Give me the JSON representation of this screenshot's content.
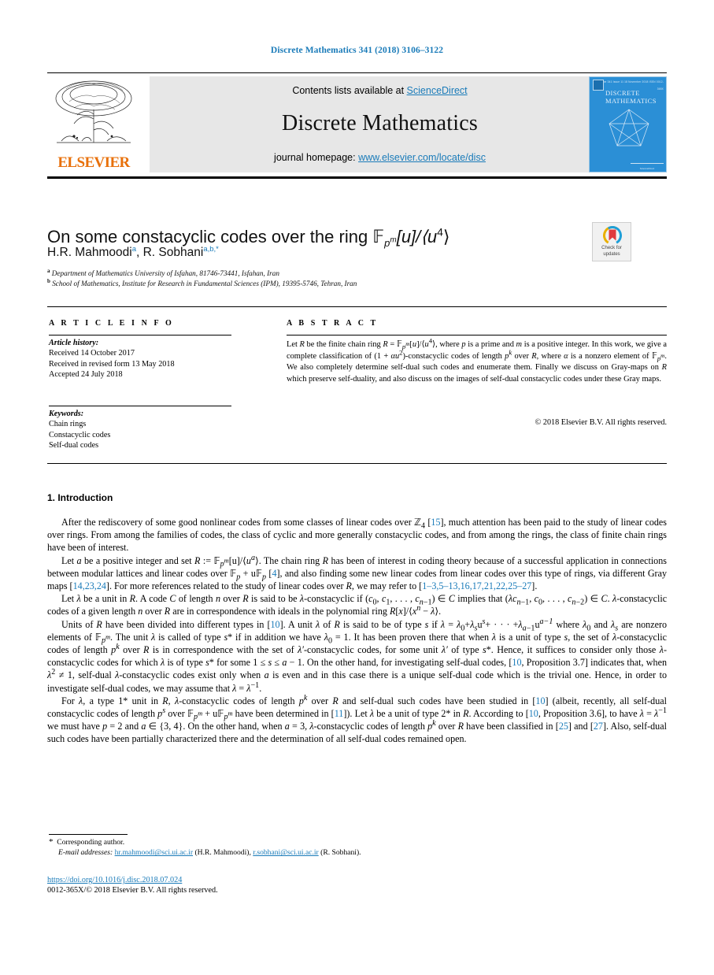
{
  "running_head": "Discrete Mathematics 341 (2018) 3106–3122",
  "masthead": {
    "contents_prefix": "Contents lists available at ",
    "contents_link": "ScienceDirect",
    "journal_title": "Discrete Mathematics",
    "homepage_prefix": "journal homepage: ",
    "homepage_url": "www.elsevier.com/locate/disc",
    "publisher": "ELSEVIER",
    "cover": {
      "journal_name_line1": "DISCRETE",
      "journal_name_line2": "MATHEMATICS",
      "top_strip": "Volume 341   Issue 11   18 November 2018   ISSN 0012-365X"
    }
  },
  "article": {
    "title": "On some constacyclic codes over the ring 𝔽_{p^m}[u]/⟨u⁴⟩",
    "title_parts": {
      "lead": "On some constacyclic codes over the ring ",
      "field": "F",
      "field_sub_p": "p",
      "field_sup_m": "m",
      "bracket_u": "[u]/⟨u",
      "sup_4": "4",
      "close": "⟩"
    },
    "authors": "H.R. Mahmoodi, R. Sobhani",
    "author_list": [
      {
        "name": "H.R. Mahmoodi",
        "marks": "a"
      },
      {
        "name": "R. Sobhani",
        "marks": "a,b,*"
      }
    ],
    "affiliations": [
      {
        "mark": "a",
        "text": "Department of Mathematics University of Isfahan, 81746-73441, Isfahan, Iran"
      },
      {
        "mark": "b",
        "text": "School of Mathematics, Institute for Research in Fundamental Sciences (IPM), 19395-5746, Tehran, Iran"
      }
    ],
    "crossmark_label_line1": "Check for",
    "crossmark_label_line2": "updates"
  },
  "info": {
    "heading": "A R T I C L E   I N F O",
    "history_label": "Article history:",
    "history": [
      "Received 14 October 2017",
      "Received in revised form 13 May 2018",
      "Accepted 24 July 2018"
    ],
    "keywords_label": "Keywords:",
    "keywords": [
      "Chain rings",
      "Constacyclic codes",
      "Self-dual codes"
    ]
  },
  "abstract": {
    "heading": "A B S T R A C T",
    "copyright": "© 2018 Elsevier B.V. All rights reserved."
  },
  "introduction": {
    "heading": "1. Introduction"
  },
  "footnote": {
    "corresponding": "Corresponding author.",
    "email_label": "E-mail addresses:",
    "email1": "hr.mahmoodi@sci.ui.ac.ir",
    "email1_owner": "(H.R. Mahmoodi),",
    "email2": "r.sobhani@sci.ui.ac.ir",
    "email2_owner": "(R. Sobhani)."
  },
  "doi": "https://doi.org/10.1016/j.disc.2018.07.024",
  "issn_line": "0012-365X/© 2018 Elsevier B.V. All rights reserved.",
  "colors": {
    "link_blue": "#1a7bb9",
    "elsevier_orange": "#E8700A",
    "cover_blue": "#2b8fd6",
    "band_gray": "#e7e7e7"
  }
}
